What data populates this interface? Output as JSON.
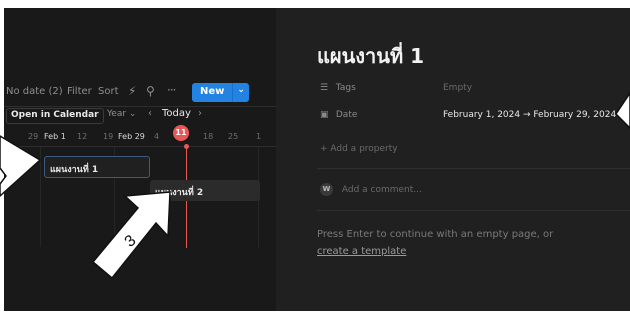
{
  "toolbar": {
    "no_date": "No date (2)",
    "filter": "Filter",
    "sort": "Sort",
    "bolt_icon": "⚡",
    "search_icon": "⚲",
    "more_icon": "···",
    "new_label": "New",
    "new_caret": "⌄"
  },
  "calendar": {
    "open_in_calendar": "Open in Calendar",
    "year_select": "Year ⌄",
    "prev": "‹",
    "today": "Today",
    "next": "›",
    "dates": [
      "29",
      "Feb 1",
      "12",
      "19",
      "Feb 29",
      "4",
      "18",
      "25",
      "1"
    ],
    "today_date": "11"
  },
  "timeline": {
    "item1": "แผนงานที่ 1",
    "item2": "แผนงานที่ 2"
  },
  "page": {
    "title": "แผนงานที่ 1",
    "properties": [
      {
        "icon": "☰",
        "name": "Tags",
        "value": "Empty"
      },
      {
        "icon": "▣",
        "name": "Date",
        "value": "February 1, 2024 → February 29, 2024"
      }
    ],
    "add_property": "+ Add a property",
    "comment_avatar": "W",
    "comment_placeholder": "Add a comment...",
    "hint": "Press Enter to continue with an empty page, or",
    "hint_link": "create a template"
  },
  "annotation": {
    "arrow_number": "3"
  },
  "colors": {
    "accent_blue": "#2383e2",
    "today_red": "#eb5757",
    "left_bg": "#191919",
    "right_bg": "#202020"
  }
}
